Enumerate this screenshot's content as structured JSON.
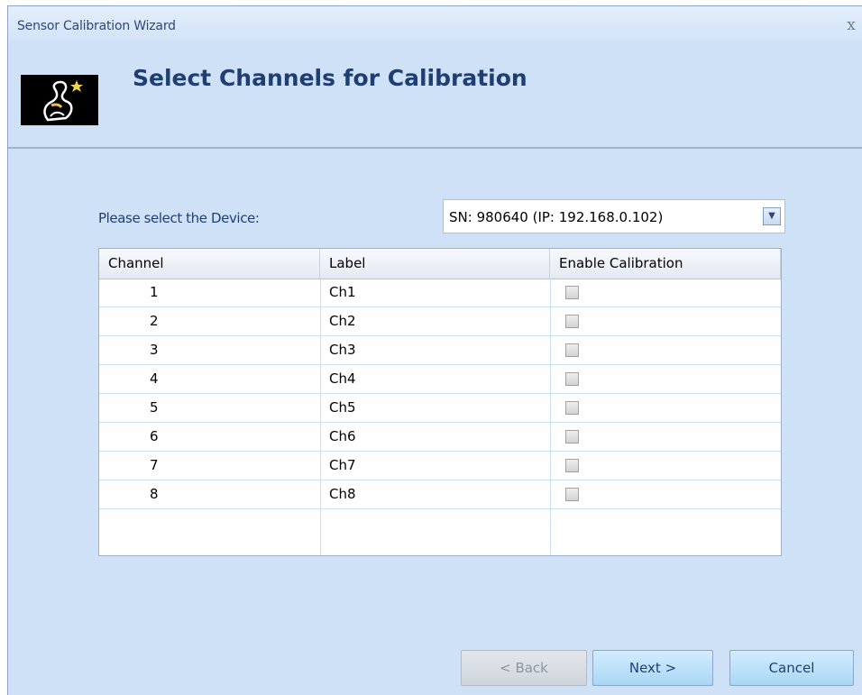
{
  "window": {
    "title": "Sensor Calibration Wizard",
    "close_glyph": "x"
  },
  "header": {
    "title": "Select Channels for Calibration",
    "logo_icon": "wizard-logo-icon"
  },
  "device": {
    "label": "Please select the Device:",
    "selected": "SN: 980640 (IP: 192.168.0.102)",
    "dropdown_glyph": "▼"
  },
  "grid": {
    "columns": [
      "Channel",
      "Label",
      "Enable Calibration"
    ],
    "rows": [
      {
        "channel": "1",
        "label": "Ch1",
        "enabled": false
      },
      {
        "channel": "2",
        "label": "Ch2",
        "enabled": false
      },
      {
        "channel": "3",
        "label": "Ch3",
        "enabled": false
      },
      {
        "channel": "4",
        "label": "Ch4",
        "enabled": false
      },
      {
        "channel": "5",
        "label": "Ch5",
        "enabled": false
      },
      {
        "channel": "6",
        "label": "Ch6",
        "enabled": false
      },
      {
        "channel": "7",
        "label": "Ch7",
        "enabled": false
      },
      {
        "channel": "8",
        "label": "Ch8",
        "enabled": false
      }
    ]
  },
  "buttons": {
    "back": "< Back",
    "next": "Next >",
    "cancel": "Cancel"
  },
  "colors": {
    "window_bg": "#cfe1f7",
    "title_text": "#1f3f72",
    "grid_line": "#c9dff0",
    "button_bg": "#a9d6f5"
  }
}
